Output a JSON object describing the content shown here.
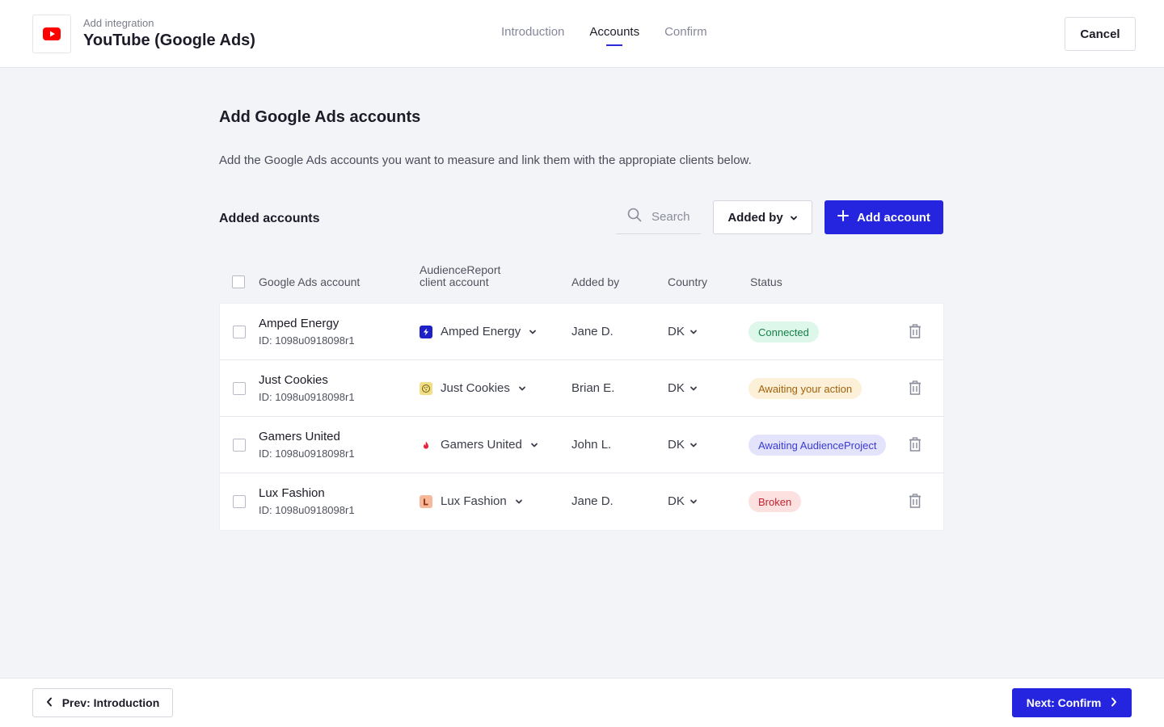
{
  "header": {
    "subtitle": "Add integration",
    "title": "YouTube (Google Ads)",
    "logo_icon": "youtube-logo-icon",
    "cancel_label": "Cancel"
  },
  "tabs": [
    {
      "label": "Introduction",
      "active": false
    },
    {
      "label": "Accounts",
      "active": true
    },
    {
      "label": "Confirm",
      "active": false
    }
  ],
  "main": {
    "title": "Add Google Ads accounts",
    "description": "Add the Google Ads accounts you want to measure and link them with the appropiate clients below.",
    "section_title": "Added accounts"
  },
  "toolbar": {
    "search_placeholder": "Search",
    "added_by_label": "Added by",
    "add_account_label": "Add account"
  },
  "table": {
    "columns": {
      "account": "Google Ads account",
      "client_line1": "AudienceReport",
      "client_line2": "client account",
      "added_by": "Added by",
      "country": "Country",
      "status": "Status"
    },
    "rows": [
      {
        "name": "Amped Energy",
        "id": "ID: 1098u0918098r1",
        "client": "Amped Energy",
        "client_icon": "lightning-icon",
        "added_by": "Jane D.",
        "country": "DK",
        "status": "Connected"
      },
      {
        "name": "Just Cookies",
        "id": "ID: 1098u0918098r1",
        "client": "Just Cookies",
        "client_icon": "cookie-icon",
        "added_by": "Brian E.",
        "country": "DK",
        "status": "Awaiting your action"
      },
      {
        "name": "Gamers United",
        "id": "ID: 1098u0918098r1",
        "client": "Gamers United",
        "client_icon": "flame-icon",
        "added_by": "John L.",
        "country": "DK",
        "status": "Awaiting AudienceProject"
      },
      {
        "name": "Lux Fashion",
        "id": "ID: 1098u0918098r1",
        "client": "Lux Fashion",
        "client_icon": "lux-logo-icon",
        "added_by": "Jane D.",
        "country": "DK",
        "status": "Broken"
      }
    ]
  },
  "footer": {
    "prev_label": "Prev: Introduction",
    "next_label": "Next: Confirm"
  },
  "colors": {
    "accent": "#2525e0",
    "youtube_red": "#ff0000",
    "connected_bg": "#ddf7ea",
    "connected_fg": "#168046",
    "awaiting_action_bg": "#fdf0d9",
    "awaiting_action_fg": "#a0620b",
    "awaiting_ap_bg": "#e3e3fc",
    "awaiting_ap_fg": "#3a3ad6",
    "broken_bg": "#fde1e1",
    "broken_fg": "#c4232e"
  }
}
